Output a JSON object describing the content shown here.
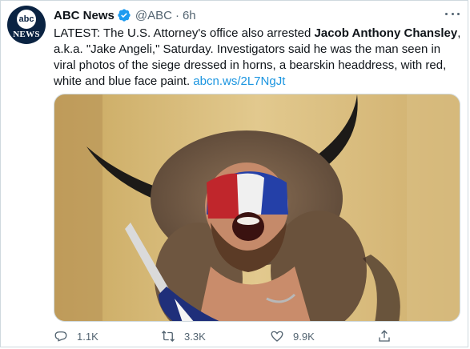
{
  "tweet": {
    "author_name": "ABC News",
    "handle": "@ABC",
    "separator": "·",
    "time": "6h",
    "avatar_top": "abc",
    "avatar_bottom": "NEWS",
    "text_parts": {
      "p1": "LATEST: The U.S. Attorney's office also arrested ",
      "bold": "Jacob Anthony Chansley",
      "p2": ", a.k.a. \"Jake Angeli,\" Saturday. Investigators said he was the man seen in viral photos of the siege dressed in horns, a bearskin headdress, with red, white and blue face paint. ",
      "link": "abcn.ws/2L7NgJt"
    },
    "media": {
      "description_icon": "photo"
    },
    "actions": {
      "reply_count": "1.1K",
      "retweet_count": "3.3K",
      "like_count": "9.9K"
    }
  },
  "colors": {
    "link": "#1b95e0",
    "verified": "#1d9bf0",
    "secondary_text": "#536471"
  }
}
